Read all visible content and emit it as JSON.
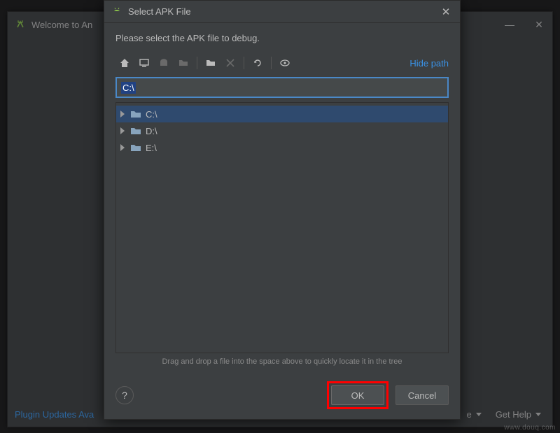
{
  "bg_window": {
    "title": "Welcome to An",
    "controls": {
      "minimize": "—",
      "close": "✕"
    },
    "status_text": "Plugin Updates Ava",
    "right_menu": {
      "first_partial": "e",
      "get_help": "Get Help"
    }
  },
  "dialog": {
    "title": "Select APK File",
    "close_glyph": "✕",
    "prompt": "Please select the APK file to debug.",
    "toolbar": {
      "home": "home-icon",
      "desktop": "desktop-icon",
      "module": "module-icon",
      "project": "project-folder-icon",
      "new_folder": "new-folder-icon",
      "delete": "delete-icon",
      "refresh": "refresh-icon",
      "show_hidden": "show-hidden-icon",
      "hide_path_label": "Hide path"
    },
    "path_input": {
      "value": "C:\\"
    },
    "tree": {
      "rows": [
        {
          "label": "C:\\",
          "selected": true
        },
        {
          "label": "D:\\",
          "selected": false
        },
        {
          "label": "E:\\",
          "selected": false
        }
      ]
    },
    "drag_hint": "Drag and drop a file into the space above to quickly locate it in the tree",
    "buttons": {
      "help_glyph": "?",
      "ok": "OK",
      "cancel": "Cancel"
    }
  },
  "watermark": "www.douq.com"
}
